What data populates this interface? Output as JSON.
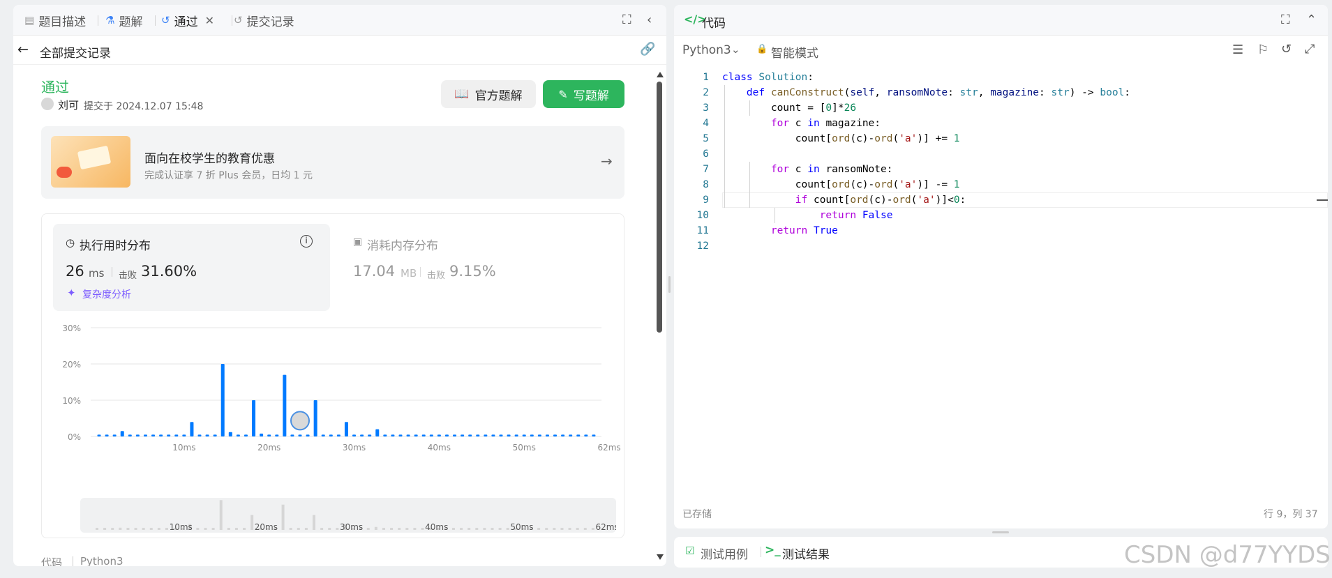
{
  "left": {
    "tabs": [
      {
        "label": "题目描述",
        "icon": "description-icon"
      },
      {
        "label": "题解",
        "icon": "flask-icon"
      },
      {
        "label": "通过",
        "icon": "history-icon"
      },
      {
        "label": "提交记录",
        "icon": "history-icon"
      }
    ],
    "back_label": "全部提交记录",
    "status": "通过",
    "user": "刘可",
    "submitted": "提交于 2024.12.07 15:48",
    "official_solution_label": "官方题解",
    "write_solution_label": "写题解",
    "promo": {
      "title": "面向在校学生的教育优惠",
      "subtitle": "完成认证享 7 折 Plus 会员，日均 1 元"
    },
    "runtime": {
      "title": "执行用时分布",
      "value": "26",
      "unit": "ms",
      "beats_label": "击败",
      "beats": "31.60%",
      "complexity_label": "复杂度分析"
    },
    "memory": {
      "title": "消耗内存分布",
      "value": "17.04",
      "unit": "MB",
      "beats_label": "击败",
      "beats": "9.15%"
    },
    "footer": {
      "code_label": "代码",
      "lang": "Python3"
    }
  },
  "chart_data": {
    "type": "bar",
    "ylim": [
      0,
      30
    ],
    "yticks": [
      "30%",
      "20%",
      "10%",
      "0%"
    ],
    "xticks": [
      "10ms",
      "20ms",
      "30ms",
      "40ms",
      "50ms",
      "62ms"
    ],
    "values": [
      0.5,
      0.5,
      0.5,
      1.5,
      0.5,
      0.5,
      0.5,
      0.5,
      0.5,
      0.5,
      0.5,
      0.5,
      4,
      0.5,
      0.5,
      0.5,
      20,
      1.2,
      0.5,
      0.5,
      10,
      0.8,
      0.5,
      0.5,
      17,
      0.5,
      0.5,
      0.5,
      10,
      0.5,
      0.5,
      0.5,
      4,
      0.5,
      0.5,
      0.5,
      2,
      0.5,
      0.5,
      0.5,
      0.5,
      0.5,
      0.5,
      0.5,
      0.5,
      0.5,
      0.5,
      0.5,
      0.5,
      0.5,
      0.5,
      0.5,
      0.5,
      0.5,
      0.5,
      0.5,
      0.5,
      0.5,
      0.5,
      0.5,
      0.5,
      0.5,
      0.5,
      0.5,
      0.5
    ],
    "highlight_index": 26,
    "bar_color": "#007aff"
  },
  "right": {
    "title": "代码",
    "lang": "Python3",
    "mode": "智能模式",
    "saved": "已存储",
    "cursor": "行 9，列 37",
    "watermark": "CSDN @d77YYDS"
  },
  "bottom": {
    "testcase_label": "测试用例",
    "result_label": "测试结果"
  }
}
